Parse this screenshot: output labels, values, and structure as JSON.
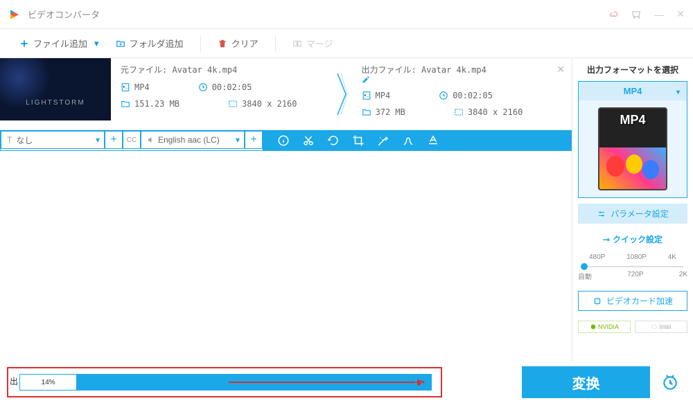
{
  "titlebar": {
    "title": "ビデオコンバータ"
  },
  "toolbar": {
    "add_file": "ファイル追加",
    "add_folder": "フォルダ追加",
    "clear": "クリア",
    "merge": "マージ"
  },
  "file": {
    "thumb_text": "LIGHTSTORM",
    "source": {
      "header": "元ファイル: Avatar 4k.mp4",
      "format": "MP4",
      "duration": "00:02:05",
      "size": "151.23 MB",
      "resolution": "3840 x 2160"
    },
    "output": {
      "header": "出力ファイル: Avatar 4k.mp4",
      "format": "MP4",
      "duration": "00:02:05",
      "size": "372 MB",
      "resolution": "3840 x 2160"
    },
    "subtitle_select": "なし",
    "audio_select": "English aac (LC)"
  },
  "sidebar": {
    "header": "出力フォーマットを選択",
    "format_name": "MP4",
    "format_tile": "MP4",
    "param_btn": "パラメータ設定",
    "quick_label": "クイック設定",
    "presets_top": [
      "480P",
      "1080P",
      "4K"
    ],
    "presets_bot": [
      "自動",
      "720P",
      "2K"
    ],
    "gpu_btn": "ビデオカード加速",
    "gpu_nv": "NVIDIA",
    "gpu_intel": "Intel"
  },
  "footer": {
    "out_label": "出",
    "progress_pct": "14%",
    "progress_value": 14,
    "convert_btn": "変换"
  }
}
